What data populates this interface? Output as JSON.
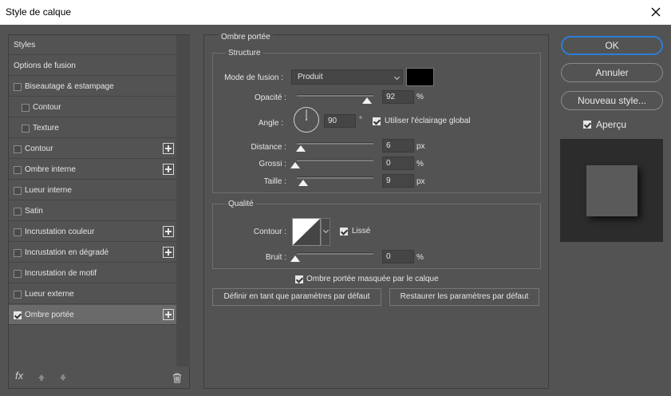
{
  "window": {
    "title": "Style de calque"
  },
  "left_panel": {
    "items": [
      {
        "label": "Styles",
        "checkbox": false,
        "checked": false,
        "indent": false,
        "plus": false,
        "selected": false
      },
      {
        "label": "Options de fusion",
        "checkbox": false,
        "checked": false,
        "indent": false,
        "plus": false,
        "selected": false
      },
      {
        "label": "Biseautage & estampage",
        "checkbox": true,
        "checked": false,
        "indent": false,
        "plus": false,
        "selected": false
      },
      {
        "label": "Contour",
        "checkbox": true,
        "checked": false,
        "indent": true,
        "plus": false,
        "selected": false
      },
      {
        "label": "Texture",
        "checkbox": true,
        "checked": false,
        "indent": true,
        "plus": false,
        "selected": false
      },
      {
        "label": "Contour",
        "checkbox": true,
        "checked": false,
        "indent": false,
        "plus": true,
        "selected": false
      },
      {
        "label": "Ombre interne",
        "checkbox": true,
        "checked": false,
        "indent": false,
        "plus": true,
        "selected": false
      },
      {
        "label": "Lueur interne",
        "checkbox": true,
        "checked": false,
        "indent": false,
        "plus": false,
        "selected": false
      },
      {
        "label": "Satin",
        "checkbox": true,
        "checked": false,
        "indent": false,
        "plus": false,
        "selected": false
      },
      {
        "label": "Incrustation couleur",
        "checkbox": true,
        "checked": false,
        "indent": false,
        "plus": true,
        "selected": false
      },
      {
        "label": "Incrustation en dégradé",
        "checkbox": true,
        "checked": false,
        "indent": false,
        "plus": true,
        "selected": false
      },
      {
        "label": "Incrustation de motif",
        "checkbox": true,
        "checked": false,
        "indent": false,
        "plus": false,
        "selected": false
      },
      {
        "label": "Lueur externe",
        "checkbox": true,
        "checked": false,
        "indent": false,
        "plus": false,
        "selected": false
      },
      {
        "label": "Ombre portée",
        "checkbox": true,
        "checked": true,
        "indent": false,
        "plus": true,
        "selected": true
      }
    ],
    "toolbar": {
      "fx_label": "fx"
    }
  },
  "drop_shadow": {
    "section_title": "Ombre portée",
    "structure": {
      "title": "Structure",
      "blend_mode_label": "Mode de fusion :",
      "blend_mode_value": "Produit",
      "shadow_color": "#000000",
      "opacity_label": "Opacité :",
      "opacity_value": "92",
      "opacity_unit": "%",
      "opacity_fraction": 0.92,
      "angle_label": "Angle :",
      "angle_value": "90",
      "angle_unit": "°",
      "global_light_label": "Utiliser l'éclairage global",
      "global_light_checked": true,
      "distance_label": "Distance :",
      "distance_value": "6",
      "distance_unit": "px",
      "spread_label": "Grossi :",
      "spread_value": "0",
      "spread_unit": "%",
      "size_label": "Taille :",
      "size_value": "9",
      "size_unit": "px"
    },
    "quality": {
      "title": "Qualité",
      "contour_label": "Contour :",
      "antialias_label": "Lissé",
      "antialias_checked": true,
      "noise_label": "Bruit :",
      "noise_value": "0",
      "noise_unit": "%"
    },
    "knockout_label": "Ombre portée masquée par le calque",
    "knockout_checked": true,
    "make_default_label": "Définir en tant que paramètres par défaut",
    "reset_default_label": "Restaurer les paramètres par défaut"
  },
  "right_panel": {
    "ok_label": "OK",
    "cancel_label": "Annuler",
    "new_style_label": "Nouveau style...",
    "preview_label": "Aperçu",
    "preview_checked": true
  },
  "colors": {
    "accent": "#2d7cd6",
    "background": "#535353"
  }
}
